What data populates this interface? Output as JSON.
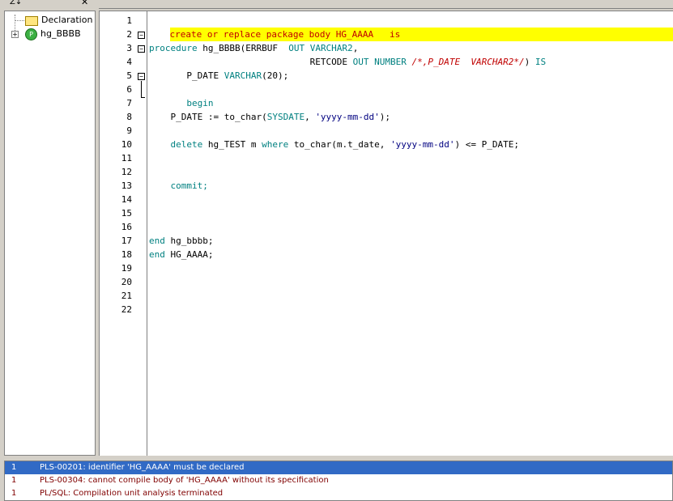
{
  "top_left_label": "Z↓",
  "close_glyph": "✕",
  "tree": {
    "items": [
      {
        "label": "Declaration",
        "icon": "folder-icon"
      },
      {
        "label": "hg_BBBB",
        "icon": "package-procedure-icon",
        "expander": "+"
      }
    ]
  },
  "editor": {
    "lines": [
      {
        "n": "1"
      },
      {
        "n": "2"
      },
      {
        "n": "3"
      },
      {
        "n": "4"
      },
      {
        "n": "5"
      },
      {
        "n": "6"
      },
      {
        "n": "7"
      },
      {
        "n": "8"
      },
      {
        "n": "9"
      },
      {
        "n": "10"
      },
      {
        "n": "11"
      },
      {
        "n": "12"
      },
      {
        "n": "13"
      },
      {
        "n": "14"
      },
      {
        "n": "15"
      },
      {
        "n": "16"
      },
      {
        "n": "17"
      },
      {
        "n": "18"
      },
      {
        "n": "19"
      },
      {
        "n": "20"
      },
      {
        "n": "21"
      },
      {
        "n": "22"
      }
    ],
    "code": {
      "l1": "create or replace package body HG_AAAA   is",
      "l3a": "procedure",
      "l3b": " hg_BBBB(ERRBUF  ",
      "l3c": "OUT VARCHAR2",
      "l3d": ",",
      "l4a": "                              RETCODE ",
      "l4b": "OUT NUMBER",
      "l4c": " /*,P_DATE  VARCHAR2*/",
      "l4d": ") ",
      "l4e": "IS",
      "l5a": "       P_DATE ",
      "l5b": "VARCHAR",
      "l5c": "(20);",
      "l7": "       begin",
      "l8a": "    P_DATE := to_char(",
      "l8b": "SYSDATE",
      "l8c": ", ",
      "l8d": "'yyyy-mm-dd'",
      "l8e": ");",
      "l10a": "    delete",
      "l10b": " hg_TEST m ",
      "l10c": "where",
      "l10d": " to_char(m.t_date, ",
      "l10e": "'yyyy-mm-dd'",
      "l10f": ") <= P_DATE;",
      "l13": "    commit;",
      "l17a": "end",
      "l17b": " hg_bbbb;",
      "l18a": "end",
      "l18b": " HG_AAAA;"
    },
    "folds": [
      {
        "line": 2,
        "glyph": "−"
      },
      {
        "line": 3,
        "glyph": "−"
      },
      {
        "line": 5,
        "glyph": "−"
      }
    ]
  },
  "errors": [
    {
      "num": "1",
      "msg": "PLS-00201: identifier 'HG_AAAA' must be declared",
      "selected": true
    },
    {
      "num": "1",
      "msg": "PLS-00304: cannot compile body of 'HG_AAAA' without its specification",
      "selected": false
    },
    {
      "num": "1",
      "msg": "PL/SQL: Compilation unit analysis terminated",
      "selected": false
    }
  ],
  "colors": {
    "selection": "#316ac5",
    "error_text": "#800000",
    "highlight": "#ffff00"
  }
}
